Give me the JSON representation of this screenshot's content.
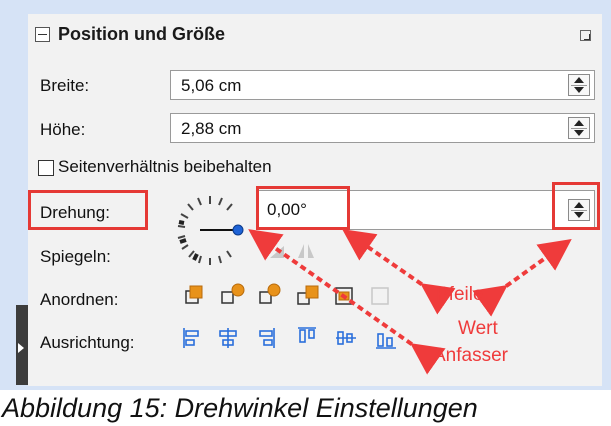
{
  "panel": {
    "title": "Position und Größe",
    "width_label": "Breite:",
    "width_value": "5,06 cm",
    "height_label": "Höhe:",
    "height_value": "2,88 cm",
    "keep_ratio_label": "Seitenverhältnis beibehalten",
    "rotation_label": "Drehung:",
    "rotation_value": "0,00°",
    "flip_label": "Spiegeln:",
    "arrange_label": "Anordnen:",
    "align_label": "Ausrichtung:"
  },
  "annotations": {
    "arrows": "Pfeile",
    "value": "Wert",
    "handle": "Anfasser"
  },
  "caption": "Abbildung 15: Drehwinkel Einstellungen",
  "colors": {
    "highlight": "#e53935",
    "icon_orange": "#e8921a",
    "icon_blue": "#2a6fdb"
  }
}
